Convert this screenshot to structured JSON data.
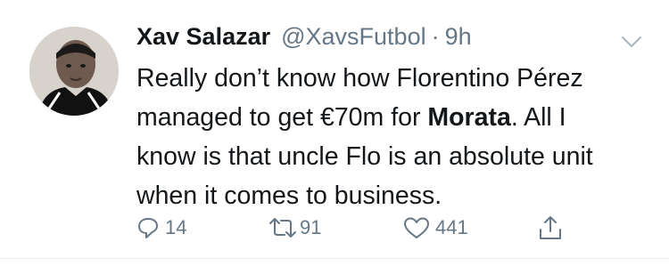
{
  "tweet": {
    "author": {
      "display_name": "Xav Salazar",
      "handle": "@XavsFutbol",
      "separator": "·",
      "time": "9h"
    },
    "text": {
      "line1": "Really don’t know how Florentino Pérez",
      "line2_pre": "managed to get €70m for ",
      "line2_bold": "Morata",
      "line2_post": ". All I",
      "line3": "know is that uncle Flo is an absolute unit",
      "line4": "when it comes to business."
    },
    "actions": {
      "replies": "14",
      "retweets": "91",
      "likes": "441"
    },
    "icons": {
      "reply": "reply-icon",
      "retweet": "retweet-icon",
      "like": "heart-icon",
      "share": "share-icon",
      "more": "chevron-down-icon"
    },
    "colors": {
      "text": "#14171a",
      "secondary": "#657786"
    }
  }
}
